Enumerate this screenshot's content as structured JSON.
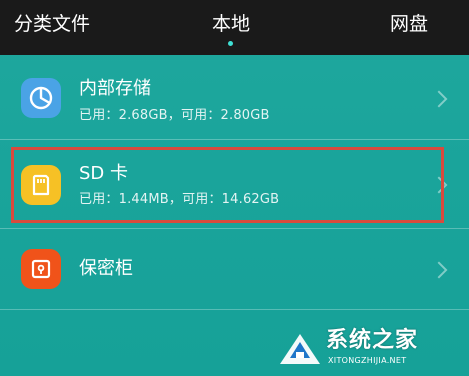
{
  "tabs": {
    "left": "分类文件",
    "center": "本地",
    "right": "网盘"
  },
  "rows": [
    {
      "title": "内部存储",
      "subtitle": "已用：2.68GB，可用：2.80GB",
      "icon": "pie-chart-icon",
      "icon_color": "#4aa3e6"
    },
    {
      "title": "SD 卡",
      "subtitle": "已用：1.44MB，可用：14.62GB",
      "icon": "sd-card-icon",
      "icon_color": "#f6c125"
    },
    {
      "title": "保密柜",
      "icon": "safe-icon",
      "icon_color": "#f0531a"
    }
  ],
  "colors": {
    "tabbar": "#1a1a1a",
    "background": "#1aa49b",
    "active_indicator": "#3fe0d4",
    "highlight_border": "#d94a3d"
  },
  "watermark": {
    "title": "系统之家",
    "url": "XITONGZHIJIA.NET"
  }
}
